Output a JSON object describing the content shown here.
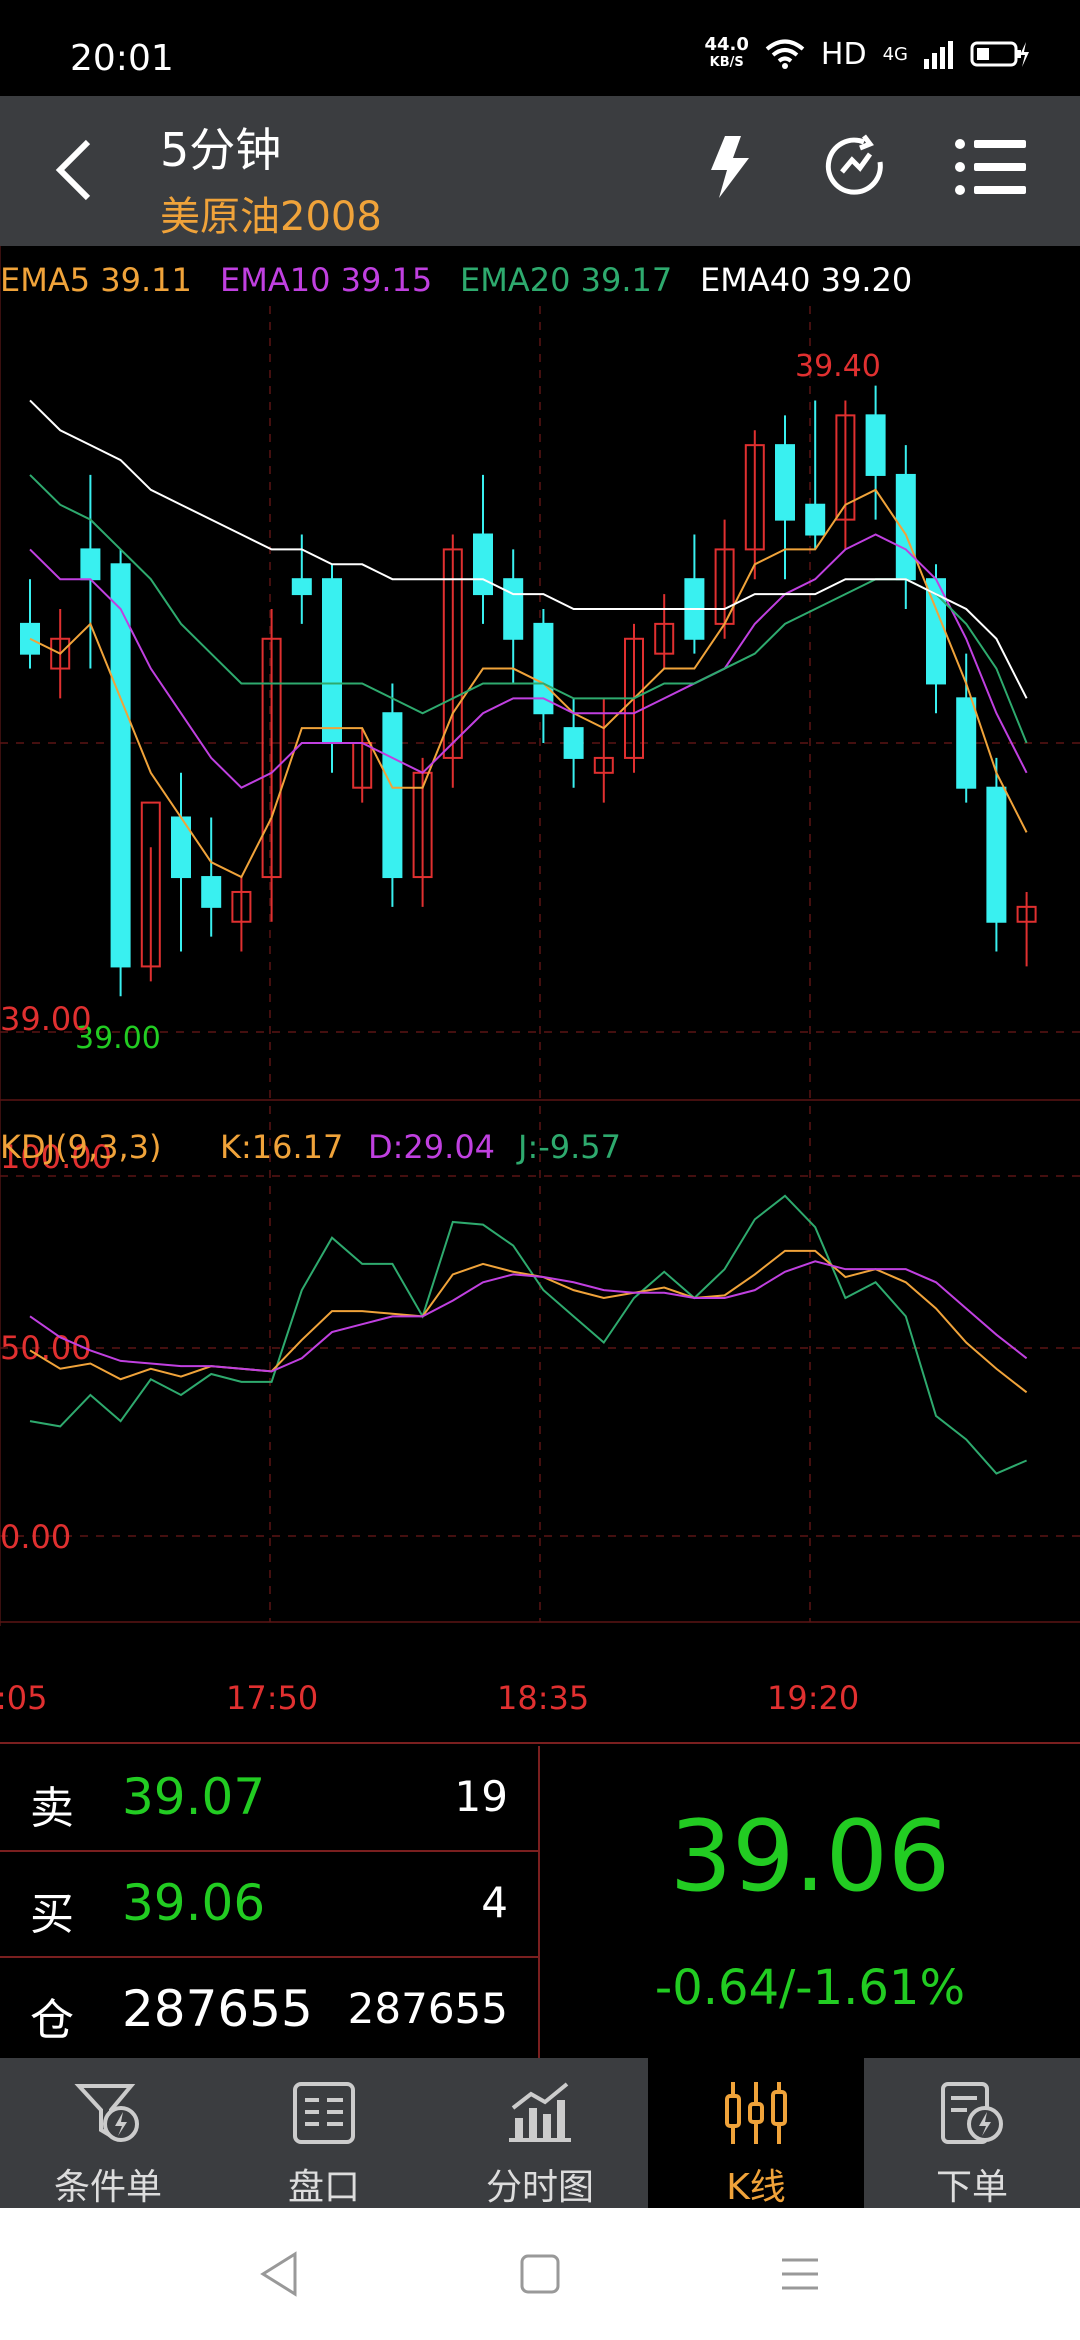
{
  "status_bar": {
    "time": "20:01",
    "net_speed_value": "44.0",
    "net_speed_unit": "KB/S",
    "hd_label": "HD",
    "network_label": "4G"
  },
  "header": {
    "title": "5分钟",
    "subtitle": "美原油2008"
  },
  "chart_data": {
    "type": "candlestick",
    "period": "5分钟",
    "main": {
      "ema_labels": [
        {
          "text": "EMA5 39.11",
          "color": "#f0a33a"
        },
        {
          "text": "EMA10 39.15",
          "color": "#c040e0"
        },
        {
          "text": "EMA20 39.17",
          "color": "#2eaa6e"
        },
        {
          "text": "EMA40 39.20",
          "color": "#ffffff"
        }
      ],
      "high_label": "39.40",
      "low_label": "39.00",
      "price_axis_label": "39.00",
      "ylim": [
        38.98,
        39.45
      ],
      "candles": [
        {
          "o": 39.25,
          "h": 39.28,
          "l": 39.22,
          "c": 39.23
        },
        {
          "o": 39.22,
          "h": 39.26,
          "l": 39.2,
          "c": 39.24
        },
        {
          "o": 39.3,
          "h": 39.35,
          "l": 39.22,
          "c": 39.28
        },
        {
          "o": 39.29,
          "h": 39.3,
          "l": 39.0,
          "c": 39.02
        },
        {
          "o": 39.02,
          "h": 39.1,
          "l": 39.01,
          "c": 39.13
        },
        {
          "o": 39.12,
          "h": 39.15,
          "l": 39.03,
          "c": 39.08
        },
        {
          "o": 39.08,
          "h": 39.12,
          "l": 39.04,
          "c": 39.06
        },
        {
          "o": 39.05,
          "h": 39.08,
          "l": 39.03,
          "c": 39.07
        },
        {
          "o": 39.08,
          "h": 39.26,
          "l": 39.05,
          "c": 39.24
        },
        {
          "o": 39.28,
          "h": 39.31,
          "l": 39.25,
          "c": 39.27
        },
        {
          "o": 39.28,
          "h": 39.29,
          "l": 39.15,
          "c": 39.17
        },
        {
          "o": 39.14,
          "h": 39.18,
          "l": 39.13,
          "c": 39.17
        },
        {
          "o": 39.19,
          "h": 39.21,
          "l": 39.06,
          "c": 39.08
        },
        {
          "o": 39.08,
          "h": 39.16,
          "l": 39.06,
          "c": 39.15
        },
        {
          "o": 39.16,
          "h": 39.31,
          "l": 39.14,
          "c": 39.3
        },
        {
          "o": 39.31,
          "h": 39.35,
          "l": 39.25,
          "c": 39.27
        },
        {
          "o": 39.28,
          "h": 39.3,
          "l": 39.21,
          "c": 39.24
        },
        {
          "o": 39.25,
          "h": 39.26,
          "l": 39.17,
          "c": 39.19
        },
        {
          "o": 39.18,
          "h": 39.2,
          "l": 39.14,
          "c": 39.16
        },
        {
          "o": 39.15,
          "h": 39.2,
          "l": 39.13,
          "c": 39.16
        },
        {
          "o": 39.16,
          "h": 39.25,
          "l": 39.15,
          "c": 39.24
        },
        {
          "o": 39.23,
          "h": 39.27,
          "l": 39.22,
          "c": 39.25
        },
        {
          "o": 39.28,
          "h": 39.31,
          "l": 39.23,
          "c": 39.24
        },
        {
          "o": 39.25,
          "h": 39.32,
          "l": 39.24,
          "c": 39.3
        },
        {
          "o": 39.3,
          "h": 39.38,
          "l": 39.28,
          "c": 39.37
        },
        {
          "o": 39.37,
          "h": 39.39,
          "l": 39.28,
          "c": 39.32
        },
        {
          "o": 39.33,
          "h": 39.4,
          "l": 39.3,
          "c": 39.31
        },
        {
          "o": 39.32,
          "h": 39.4,
          "l": 39.3,
          "c": 39.39
        },
        {
          "o": 39.39,
          "h": 39.41,
          "l": 39.32,
          "c": 39.35
        },
        {
          "o": 39.35,
          "h": 39.37,
          "l": 39.26,
          "c": 39.28
        },
        {
          "o": 39.28,
          "h": 39.29,
          "l": 39.19,
          "c": 39.21
        },
        {
          "o": 39.2,
          "h": 39.23,
          "l": 39.13,
          "c": 39.14
        },
        {
          "o": 39.14,
          "h": 39.16,
          "l": 39.03,
          "c": 39.05
        },
        {
          "o": 39.05,
          "h": 39.07,
          "l": 39.02,
          "c": 39.06
        }
      ],
      "ema_series": {
        "EMA5": [
          39.24,
          39.23,
          39.25,
          39.2,
          39.15,
          39.12,
          39.09,
          39.08,
          39.12,
          39.18,
          39.18,
          39.18,
          39.14,
          39.14,
          39.19,
          39.22,
          39.22,
          39.21,
          39.19,
          39.18,
          39.2,
          39.22,
          39.22,
          39.25,
          39.29,
          39.3,
          39.3,
          39.33,
          39.34,
          39.31,
          39.26,
          39.21,
          39.15,
          39.11
        ],
        "EMA10": [
          39.3,
          39.28,
          39.28,
          39.26,
          39.22,
          39.19,
          39.16,
          39.14,
          39.15,
          39.17,
          39.17,
          39.17,
          39.16,
          39.15,
          39.17,
          39.19,
          39.2,
          39.2,
          39.19,
          39.19,
          39.19,
          39.2,
          39.21,
          39.22,
          39.25,
          39.27,
          39.28,
          39.3,
          39.31,
          39.3,
          39.28,
          39.24,
          39.19,
          39.15
        ],
        "EMA20": [
          39.35,
          39.33,
          39.32,
          39.3,
          39.28,
          39.25,
          39.23,
          39.21,
          39.21,
          39.21,
          39.21,
          39.21,
          39.2,
          39.19,
          39.2,
          39.21,
          39.21,
          39.21,
          39.2,
          39.2,
          39.2,
          39.21,
          39.21,
          39.22,
          39.23,
          39.25,
          39.26,
          39.27,
          39.28,
          39.28,
          39.27,
          39.25,
          39.22,
          39.17
        ],
        "EMA40": [
          39.4,
          39.38,
          39.37,
          39.36,
          39.34,
          39.33,
          39.32,
          39.31,
          39.3,
          39.3,
          39.29,
          39.29,
          39.28,
          39.28,
          39.28,
          39.28,
          39.27,
          39.27,
          39.26,
          39.26,
          39.26,
          39.26,
          39.26,
          39.26,
          39.27,
          39.27,
          39.27,
          39.28,
          39.28,
          39.28,
          39.27,
          39.26,
          39.24,
          39.2
        ]
      }
    },
    "kdj": {
      "label": "KDJ(9,3,3)",
      "k_label": "K:16.17",
      "d_label": "D:29.04",
      "j_label": "J:-9.57",
      "axis_labels": [
        "100.00",
        "50.00",
        "0.00"
      ],
      "ylim": [
        -35,
        110
      ],
      "K": [
        32,
        25,
        27,
        21,
        25,
        22,
        26,
        25,
        24,
        36,
        47,
        47,
        46,
        45,
        61,
        65,
        62,
        60,
        55,
        52,
        54,
        56,
        52,
        53,
        61,
        70,
        70,
        60,
        63,
        58,
        48,
        35,
        25,
        16
      ],
      "D": [
        45,
        37,
        32,
        28,
        27,
        26,
        26,
        25,
        24,
        29,
        39,
        42,
        45,
        45,
        51,
        58,
        61,
        60,
        58,
        55,
        54,
        54,
        52,
        52,
        55,
        62,
        66,
        63,
        63,
        63,
        58,
        48,
        38,
        29
      ],
      "J": [
        5,
        3,
        15,
        5,
        21,
        15,
        23,
        20,
        20,
        55,
        75,
        65,
        65,
        45,
        81,
        80,
        72,
        55,
        45,
        35,
        52,
        62,
        52,
        63,
        82,
        91,
        79,
        52,
        58,
        45,
        7,
        -2,
        -15,
        -10
      ]
    },
    "time_labels": [
      ":05",
      "17:50",
      "18:35",
      "19:20"
    ]
  },
  "quote": {
    "sell_label": "卖",
    "sell_price": "39.07",
    "sell_volume": "19",
    "buy_label": "买",
    "buy_price": "39.06",
    "buy_volume": "4",
    "position_label": "仓",
    "position_value": "287655",
    "position_value2": "287655",
    "last_price": "39.06",
    "change": "-0.64/-1.61%"
  },
  "bottom_nav": {
    "items": [
      {
        "label": "条件单"
      },
      {
        "label": "盘口"
      },
      {
        "label": "分时图"
      },
      {
        "label": "K线"
      },
      {
        "label": "下单"
      }
    ],
    "active": "K线"
  },
  "colors": {
    "up": "#e03030",
    "down": "#39f0f0",
    "grid": "#5a1414",
    "accent": "#f0a33a",
    "price_green": "#22cc22"
  }
}
